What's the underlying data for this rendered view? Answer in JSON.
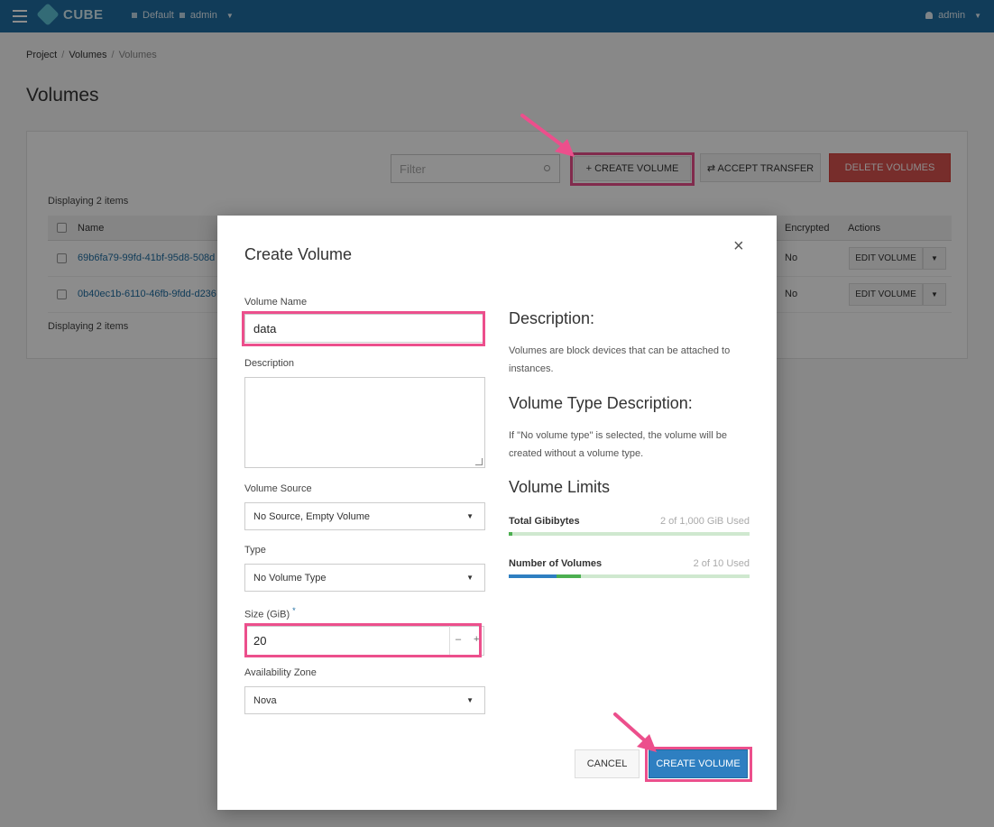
{
  "navbar": {
    "brand": "CUBE",
    "domain": "Default",
    "project": "admin",
    "user": "admin"
  },
  "breadcrumb": [
    "Project",
    "Volumes",
    "Volumes"
  ],
  "page_title": "Volumes",
  "toolbar": {
    "filter_placeholder": "Filter",
    "create_label": "+ CREATE VOLUME",
    "accept_label": "⇄ ACCEPT TRANSFER",
    "delete_label": "DELETE VOLUMES"
  },
  "table": {
    "count_text": "Displaying 2 items",
    "headers": {
      "name": "Name",
      "encrypted": "Encrypted",
      "actions": "Actions"
    },
    "rows": [
      {
        "name": "69b6fa79-99fd-41bf-95d8-508d",
        "encrypted": "No",
        "action": "EDIT VOLUME"
      },
      {
        "name": "0b40ec1b-6110-46fb-9fdd-d236",
        "encrypted": "No",
        "action": "EDIT VOLUME"
      }
    ]
  },
  "modal": {
    "title": "Create Volume",
    "close_glyph": "×",
    "fields": {
      "name_label": "Volume Name",
      "name_value": "data",
      "description_label": "Description",
      "source_label": "Volume Source",
      "source_value": "No Source, Empty Volume",
      "type_label": "Type",
      "type_value": "No Volume Type",
      "size_label": "Size (GiB)",
      "size_required": "*",
      "size_value": "20",
      "zone_label": "Availability Zone",
      "zone_value": "Nova"
    },
    "side": {
      "desc_heading": "Description:",
      "desc_text": "Volumes are block devices that can be attached to instances.",
      "type_heading": "Volume Type Description:",
      "type_text": "If \"No volume type\" is selected, the volume will be created without a volume type.",
      "limits_heading": "Volume Limits",
      "gib_label": "Total Gibibytes",
      "gib_used": "2 of 1,000 GiB Used",
      "gib_fraction": 0.002,
      "vol_label": "Number of Volumes",
      "vol_used": "2 of 10 Used",
      "vol_fraction": 0.2
    },
    "cancel_label": "CANCEL",
    "submit_label": "CREATE VOLUME"
  },
  "colors": {
    "navbar": "#1f6ea3",
    "highlight": "#ec4f8c",
    "primary": "#2e7fc1",
    "danger": "#d9534f"
  }
}
